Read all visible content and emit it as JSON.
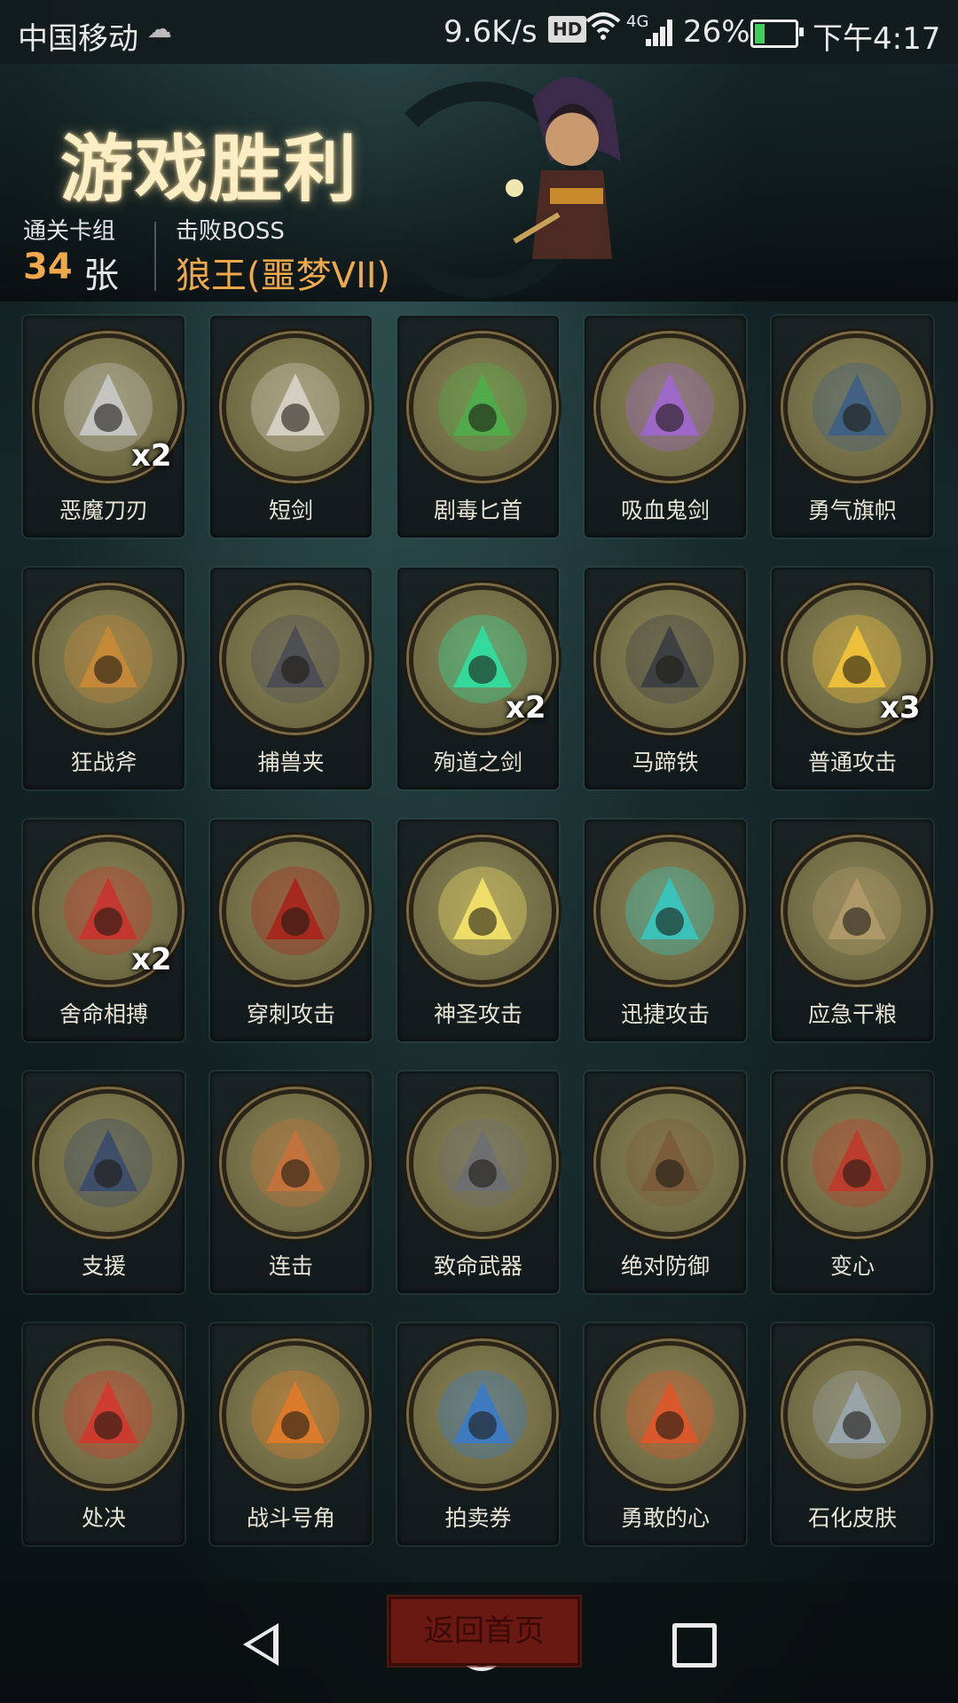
{
  "status_bar": {
    "carrier": "中国移动",
    "speed": "9.6K/s",
    "hd": "HD",
    "network": "4G",
    "battery": "26%",
    "battery_level": 0.26,
    "time": "下午4:17"
  },
  "header": {
    "title": "游戏胜利",
    "deck_label": "通关卡组",
    "deck_count": "34",
    "deck_unit": "张",
    "boss_label": "击败BOSS",
    "boss_name": "狼王(噩梦VII)"
  },
  "cards": [
    {
      "name": "恶魔刀刃",
      "count": "x2",
      "icon": "demon-blade-icon",
      "color": "#c9c9c9"
    },
    {
      "name": "短剑",
      "count": "",
      "icon": "short-sword-icon",
      "color": "#d9d4c8"
    },
    {
      "name": "剧毒匕首",
      "count": "",
      "icon": "poison-dagger-icon",
      "color": "#4fae4a"
    },
    {
      "name": "吸血鬼剑",
      "count": "",
      "icon": "vampire-sword-icon",
      "color": "#a066d0"
    },
    {
      "name": "勇气旗帜",
      "count": "",
      "icon": "courage-banner-icon",
      "color": "#3d5f86"
    },
    {
      "name": "狂战斧",
      "count": "",
      "icon": "berserk-axe-icon",
      "color": "#c98a36"
    },
    {
      "name": "捕兽夹",
      "count": "",
      "icon": "bear-trap-icon",
      "color": "#4a4a55"
    },
    {
      "name": "殉道之剑",
      "count": "x2",
      "icon": "martyr-sword-icon",
      "color": "#2ee0a0"
    },
    {
      "name": "马蹄铁",
      "count": "",
      "icon": "horseshoe-icon",
      "color": "#3a3d44"
    },
    {
      "name": "普通攻击",
      "count": "x3",
      "icon": "basic-attack-icon",
      "color": "#f3c43a"
    },
    {
      "name": "舍命相搏",
      "count": "x2",
      "icon": "desperate-fight-icon",
      "color": "#c8332c"
    },
    {
      "name": "穿刺攻击",
      "count": "",
      "icon": "pierce-attack-icon",
      "color": "#a8231c"
    },
    {
      "name": "神圣攻击",
      "count": "",
      "icon": "holy-attack-icon",
      "color": "#f5e46a"
    },
    {
      "name": "迅捷攻击",
      "count": "",
      "icon": "swift-attack-icon",
      "color": "#36c7c0"
    },
    {
      "name": "应急干粮",
      "count": "",
      "icon": "rations-icon",
      "color": "#b39a6a"
    },
    {
      "name": "支援",
      "count": "",
      "icon": "support-icon",
      "color": "#3a4a6a"
    },
    {
      "name": "连击",
      "count": "",
      "icon": "combo-icon",
      "color": "#c7723a"
    },
    {
      "name": "致命武器",
      "count": "",
      "icon": "deadly-weapons-icon",
      "color": "#6b6e72"
    },
    {
      "name": "绝对防御",
      "count": "",
      "icon": "absolute-defense-icon",
      "color": "#7a5a3a"
    },
    {
      "name": "变心",
      "count": "",
      "icon": "change-heart-icon",
      "color": "#c0392b"
    },
    {
      "name": "处决",
      "count": "",
      "icon": "execute-icon",
      "color": "#d2372c"
    },
    {
      "name": "战斗号角",
      "count": "",
      "icon": "battle-horn-icon",
      "color": "#e07a28"
    },
    {
      "name": "拍卖券",
      "count": "",
      "icon": "auction-ticket-icon",
      "color": "#3a7ac8"
    },
    {
      "name": "勇敢的心",
      "count": "",
      "icon": "brave-heart-icon",
      "color": "#e0552a"
    },
    {
      "name": "石化皮肤",
      "count": "",
      "icon": "stone-skin-icon",
      "color": "#9aa6b0"
    }
  ],
  "footer": {
    "return_label": "返回首页"
  }
}
